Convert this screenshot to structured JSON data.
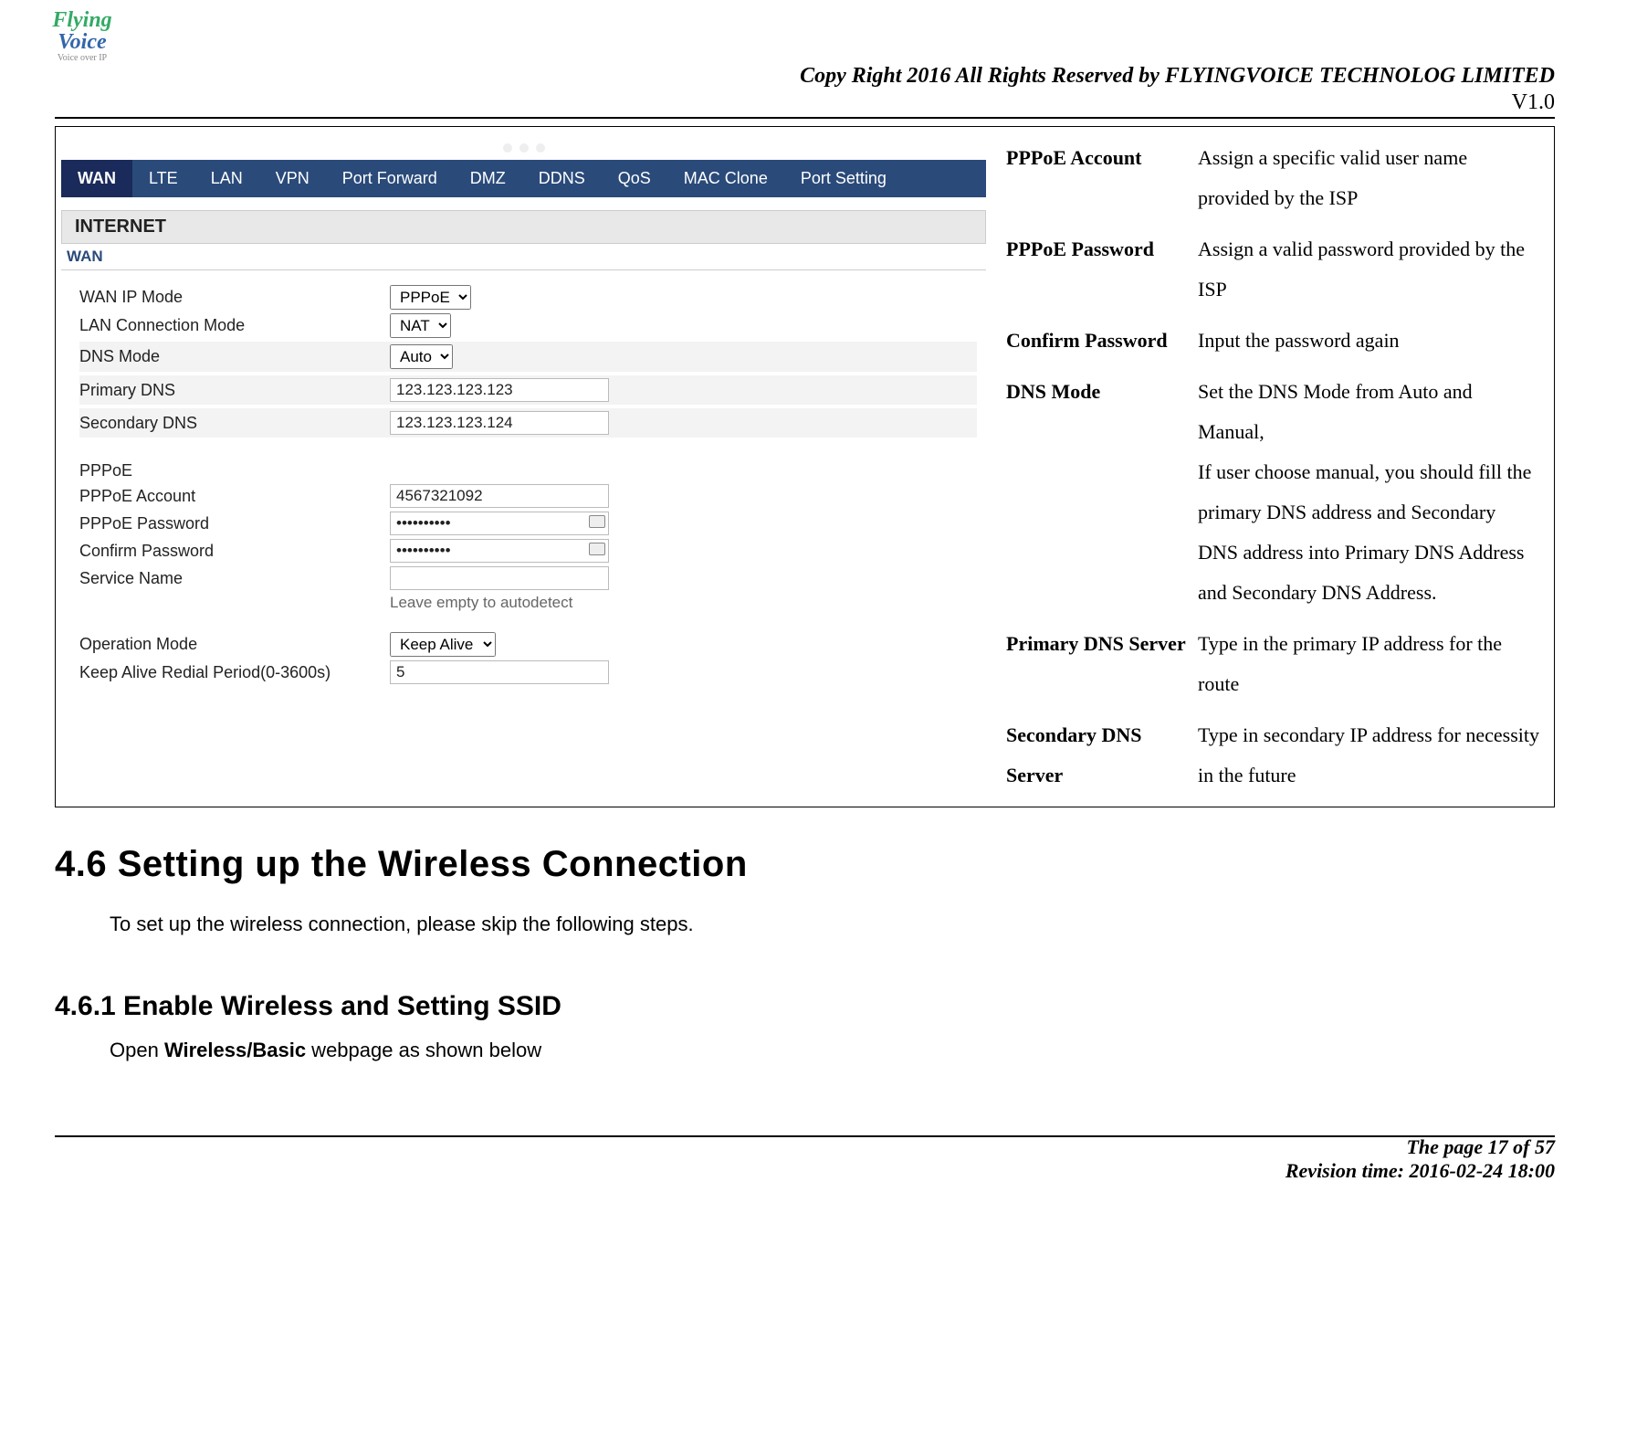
{
  "header": {
    "copyright": "Copy Right 2016 All Rights Reserved by FLYINGVOICE TECHNOLOG LIMITED",
    "version": "V1.0"
  },
  "logo": {
    "line1": "Flying",
    "line2": "Voice",
    "sub": "Voice over IP"
  },
  "screenshot": {
    "tabs": [
      "WAN",
      "LTE",
      "LAN",
      "VPN",
      "Port Forward",
      "DMZ",
      "DDNS",
      "QoS",
      "MAC Clone",
      "Port Setting"
    ],
    "active_tab_index": 0,
    "section_title": "INTERNET",
    "wan_label": "WAN",
    "fields": {
      "wan_ip_mode": {
        "label": "WAN IP Mode",
        "value": "PPPoE"
      },
      "lan_conn_mode": {
        "label": "LAN Connection Mode",
        "value": "NAT"
      },
      "dns_mode": {
        "label": "DNS Mode",
        "value": "Auto"
      },
      "primary_dns": {
        "label": "Primary DNS",
        "value": "123.123.123.123"
      },
      "secondary_dns": {
        "label": "Secondary DNS",
        "value": "123.123.123.124"
      },
      "pppoe_header": "PPPoE",
      "pppoe_account": {
        "label": "PPPoE Account",
        "value": "4567321092"
      },
      "pppoe_password": {
        "label": "PPPoE Password",
        "value": "••••••••••"
      },
      "confirm_password": {
        "label": "Confirm Password",
        "value": "••••••••••"
      },
      "service_name": {
        "label": "Service Name",
        "value": ""
      },
      "service_hint": "Leave empty to autodetect",
      "operation_mode": {
        "label": "Operation Mode",
        "value": "Keep Alive"
      },
      "redial_period": {
        "label": "Keep Alive Redial Period(0-3600s)",
        "value": "5"
      }
    }
  },
  "definitions": {
    "pppoe_account": {
      "term": "PPPoE Account",
      "def": "Assign a specific valid user name provided by the ISP"
    },
    "pppoe_password": {
      "term": "PPPoE Password",
      "def": "Assign a valid password provided by the ISP"
    },
    "confirm_password": {
      "term": "Confirm Password",
      "def": "Input the password again"
    },
    "dns_mode": {
      "term": "DNS Mode",
      "def": "Set the DNS Mode from Auto and Manual,\nIf user choose manual, you should fill the primary DNS address and Secondary DNS address into Primary DNS Address and Secondary DNS Address."
    },
    "primary_dns": {
      "term": "Primary DNS Server",
      "def": "Type in the primary IP address for the route"
    },
    "secondary_dns": {
      "term": "Secondary DNS Server",
      "def": "Type in secondary IP address for necessity in the future"
    }
  },
  "content": {
    "h46": "4.6 Setting up the Wireless Connection",
    "p46": "To set up the wireless connection, please skip the following steps.",
    "h461": "4.6.1 Enable Wireless and Setting SSID",
    "p461_pre": "Open ",
    "p461_bold": "Wireless/Basic",
    "p461_post": " webpage as shown below"
  },
  "footer": {
    "page": "The page 17 of 57",
    "rev": "Revision time: 2016-02-24 18:00"
  }
}
